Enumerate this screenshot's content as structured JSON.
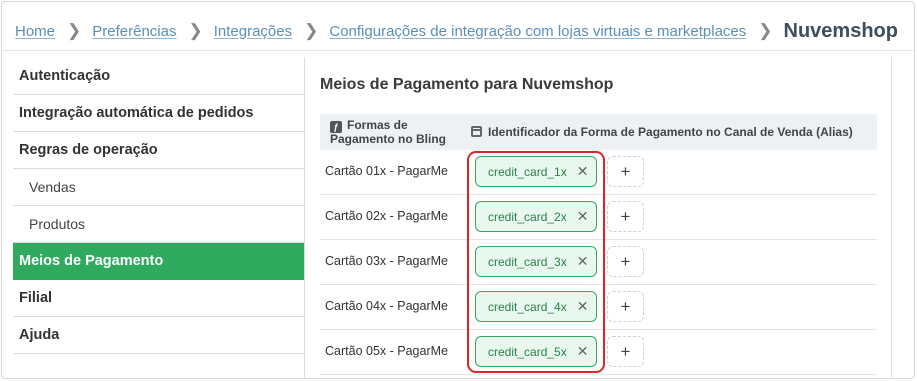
{
  "breadcrumb": {
    "items": [
      "Home",
      "Preferências",
      "Integrações",
      "Configurações de integração com lojas virtuais e marketplaces"
    ],
    "current": "Nuvemshop"
  },
  "sidebar": {
    "items": [
      {
        "label": "Autenticação"
      },
      {
        "label": "Integração automática de pedidos"
      },
      {
        "label": "Regras de operação"
      },
      {
        "label": "Vendas"
      },
      {
        "label": "Produtos"
      },
      {
        "label": "Meios de Pagamento"
      },
      {
        "label": "Filial"
      },
      {
        "label": "Ajuda"
      }
    ],
    "active": "Meios de Pagamento"
  },
  "main": {
    "title": "Meios de Pagamento para Nuvemshop",
    "columns": {
      "col1": "Formas de Pagamento no Bling",
      "col2": "Identificador da Forma de Pagamento no Canal de Venda (Alias)"
    },
    "rows": [
      {
        "label": "Cartão 01x - PagarMe",
        "alias": "credit_card_1x"
      },
      {
        "label": "Cartão 02x - PagarMe",
        "alias": "credit_card_2x"
      },
      {
        "label": "Cartão 03x - PagarMe",
        "alias": "credit_card_3x"
      },
      {
        "label": "Cartão 04x - PagarMe",
        "alias": "credit_card_4x"
      },
      {
        "label": "Cartão 05x - PagarMe",
        "alias": "credit_card_5x"
      }
    ],
    "remove_glyph": "✕",
    "add_glyph": "+"
  },
  "colors": {
    "accent": "#2faa5f",
    "link": "#5b8fb9",
    "tag_border": "#33a85c",
    "tag_bg": "#e9f8ee",
    "highlight": "#d9262c"
  }
}
